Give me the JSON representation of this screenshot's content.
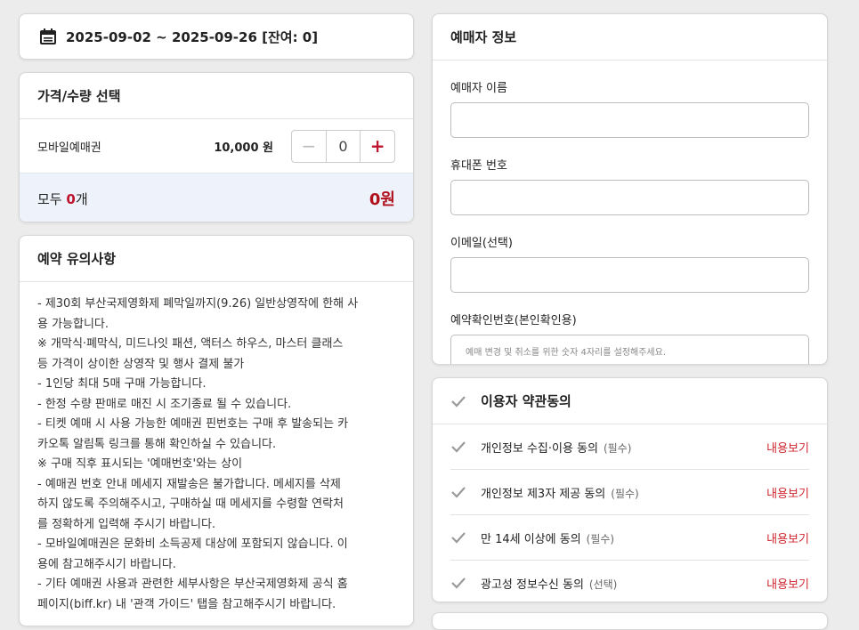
{
  "date_card": {
    "icon": "calendar-icon",
    "text": "2025-09-02 ~ 2025-09-26 [잔여: 0]"
  },
  "price_card": {
    "title": "가격/수량 선택",
    "item_name": "모바일예매권",
    "item_price": "10,000 원",
    "minus_label": "−",
    "quantity": "0",
    "plus_label": "+",
    "total_prefix": "모두 ",
    "total_count": "0",
    "total_suffix": "개",
    "total_amount": "0원"
  },
  "notice_card": {
    "title": "예약 유의사항",
    "lines": [
      "- 제30회 부산국제영화제 폐막일까지(9.26) 일반상영작에 한해 사",
      "용 가능합니다.",
      "※ 개막식·폐막식, 미드나잇 패션, 액터스 하우스, 마스터 클래스",
      "등 가격이 상이한 상영작 및 행사 결제 불가",
      "- 1인당 최대 5매 구매 가능합니다.",
      "- 한정 수량 판매로 매진 시 조기종료 될 수 있습니다.",
      "- 티켓 예매 시 사용 가능한 예매권 핀번호는 구매 후 발송되는 카",
      "카오톡 알림톡 링크를 통해 확인하실 수 있습니다.",
      "※ 구매 직후 표시되는 '예매번호'와는 상이",
      "- 예매권 번호 안내 메세지 재발송은 불가합니다. 메세지를 삭제",
      "하지 않도록 주의해주시고, 구매하실 때 메세지를 수령할 연락처",
      "를 정확하게 입력해 주시기 바랍니다.",
      "- 모바일예매권은 문화비 소득공제 대상에 포함되지 않습니다. 이",
      "용에 참고해주시기 바랍니다.",
      "- 기타 예매권 사용과 관련한 세부사항은 부산국제영화제 공식 홈",
      "페이지(biff.kr) 내 '관객 가이드' 탭을 참고해주시기 바랍니다."
    ]
  },
  "buyer_card": {
    "title": "예매자 정보",
    "name_label": "예매자 이름",
    "name_value": "",
    "phone_label": "휴대폰 번호",
    "phone_value": "",
    "email_label": "이메일(선택)",
    "email_value": "",
    "pin_label": "예약확인번호(본인확인용)",
    "pin_placeholder": "예매 변경 및 취소를 위한 숫자 4자리를 설정해주세요."
  },
  "terms_card": {
    "title": "이용자 약관동의",
    "items": [
      {
        "label": "개인정보 수집·이용 동의",
        "tag": "(필수)",
        "link": "내용보기"
      },
      {
        "label": "개인정보 제3자 제공 동의",
        "tag": "(필수)",
        "link": "내용보기"
      },
      {
        "label": "만 14세 이상에 동의",
        "tag": "(필수)",
        "link": "내용보기"
      },
      {
        "label": "광고성 정보수신 동의",
        "tag": "(선택)",
        "link": "내용보기"
      }
    ]
  },
  "colors": {
    "accent_red": "#c0152f",
    "link_red": "#d0262f",
    "total_bg": "#eef2fa",
    "page_bg": "#ececec"
  }
}
